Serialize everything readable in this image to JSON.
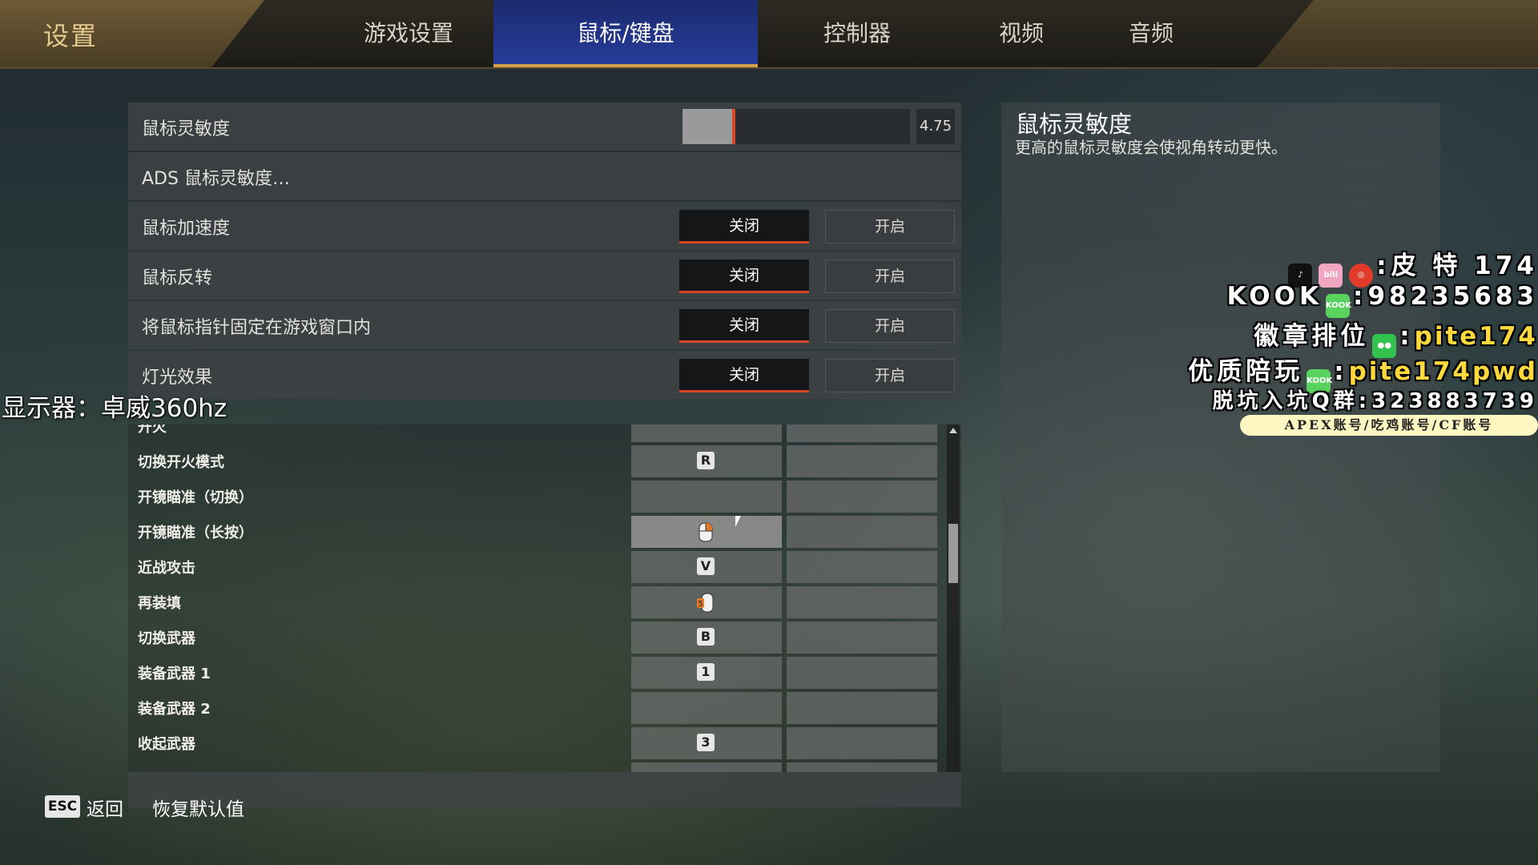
{
  "header": {
    "title": "设置",
    "tabs": [
      {
        "label": "游戏设置",
        "active": false
      },
      {
        "label": "鼠标/键盘",
        "active": true
      },
      {
        "label": "控制器",
        "active": false
      },
      {
        "label": "视频",
        "active": false
      },
      {
        "label": "音频",
        "active": false
      }
    ]
  },
  "settings": {
    "sensitivity": {
      "label": "鼠标灵敏度",
      "value": "4.75",
      "fill_fraction": 0.2
    },
    "ads_sensitivity": {
      "label": "ADS 鼠标灵敏度…"
    },
    "toggles": [
      {
        "label": "鼠标加速度",
        "off": "关闭",
        "on": "开启",
        "selected": "off"
      },
      {
        "label": "鼠标反转",
        "off": "关闭",
        "on": "开启",
        "selected": "off"
      },
      {
        "label": "将鼠标指针固定在游戏窗口内",
        "off": "关闭",
        "on": "开启",
        "selected": "off"
      },
      {
        "label": "灯光效果",
        "off": "关闭",
        "on": "开启",
        "selected": "off"
      }
    ]
  },
  "keybinds": [
    {
      "label": "开火",
      "key": ""
    },
    {
      "label": "切换开火模式",
      "key": "R"
    },
    {
      "label": "开镜瞄准（切换）",
      "key": ""
    },
    {
      "label": "开镜瞄准（长按）",
      "key": "mouse-right-icon"
    },
    {
      "label": "近战攻击",
      "key": "V"
    },
    {
      "label": "再装填",
      "key": "mouse-button-5-icon"
    },
    {
      "label": "切换武器",
      "key": "B"
    },
    {
      "label": "装备武器 1",
      "key": "1"
    },
    {
      "label": "装备武器 2",
      "key": ""
    },
    {
      "label": "收起武器",
      "key": "3"
    },
    {
      "label": "",
      "key": ""
    }
  ],
  "footer": {
    "esc_key": "ESC",
    "back": "返回",
    "reset": "恢复默认值"
  },
  "description": {
    "title": "鼠标灵敏度",
    "text": "更高的鼠标灵敏度会使视角转动更快。"
  },
  "overlay": {
    "monitor": "显示器：卓威360hz",
    "promo": [
      {
        "prefix": "",
        "icons": [
          "tiktok-icon",
          "bilibili-icon",
          "weibo-icon"
        ],
        "value": "皮 特 174"
      },
      {
        "prefix": "KOOK",
        "icons": [
          "kook-icon"
        ],
        "value": "98235683"
      },
      {
        "prefix": "徽章排位",
        "icons": [
          "wechat-icon"
        ],
        "value": "pite174"
      },
      {
        "prefix": "优质陪玩",
        "icons": [
          "kook-icon"
        ],
        "value": "pite174pwd"
      },
      {
        "prefix": "脱坑入坑Q群",
        "icons": [],
        "value": "323883739"
      }
    ],
    "banner": "APEX账号/吃鸡账号/CF账号"
  },
  "colors": {
    "accent_red": "#d4452a",
    "tab_active": "#263c9a",
    "gold": "#d1a14e",
    "promo_yellow": "#ffd93b"
  }
}
